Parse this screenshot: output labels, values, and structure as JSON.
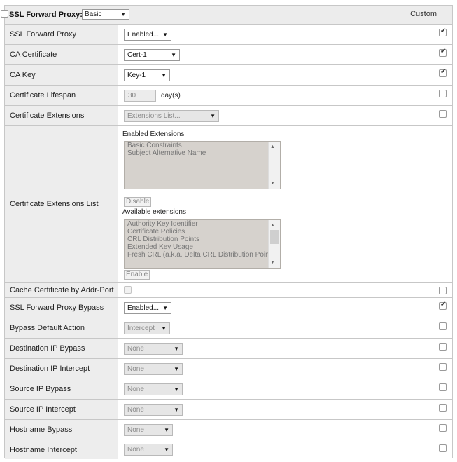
{
  "header": {
    "title": "SSL Forward Proxy:",
    "select_value": "Basic",
    "custom_label": "Custom",
    "custom_checked": false
  },
  "rows": [
    {
      "label": "SSL Forward Proxy",
      "value": "Enabled...",
      "checked": true
    },
    {
      "label": "CA Certificate",
      "value": "Cert-1",
      "checked": true
    },
    {
      "label": "CA Key",
      "value": "Key-1",
      "checked": true
    },
    {
      "label": "Certificate Lifespan",
      "value": "30",
      "unit": "day(s)",
      "checked": false
    },
    {
      "label": "Certificate Extensions",
      "value": "Extensions List...",
      "checked": false
    },
    {
      "label": "Certificate Extensions List"
    },
    {
      "label": "Cache Certificate by Addr-Port",
      "checked": false
    },
    {
      "label": "SSL Forward Proxy Bypass",
      "value": "Enabled...",
      "checked": true
    },
    {
      "label": "Bypass Default Action",
      "value": "Intercept",
      "checked": false
    },
    {
      "label": "Destination IP Bypass",
      "value": "None",
      "checked": false
    },
    {
      "label": "Destination IP Intercept",
      "value": "None",
      "checked": false
    },
    {
      "label": "Source IP Bypass",
      "value": "None",
      "checked": false
    },
    {
      "label": "Source IP Intercept",
      "value": "None",
      "checked": false
    },
    {
      "label": "Hostname Bypass",
      "value": "None",
      "checked": false
    },
    {
      "label": "Hostname Intercept",
      "value": "None",
      "checked": false
    }
  ],
  "extensions": {
    "enabled_title": "Enabled Extensions",
    "enabled_items": [
      "Basic Constraints",
      "Subject Alternative Name"
    ],
    "disable_label": "Disable",
    "available_title": "Available extensions",
    "available_items": [
      "Authority Key Identifier",
      "Certificate Policies",
      "CRL Distribution Points",
      "Extended Key Usage",
      "Fresh CRL (a.k.a. Delta CRL Distribution Point"
    ],
    "enable_label": "Enable"
  },
  "icons": {
    "dropdown": "chevron-down-icon",
    "scroll_up": "scroll-up-icon",
    "scroll_down": "scroll-down-icon"
  }
}
